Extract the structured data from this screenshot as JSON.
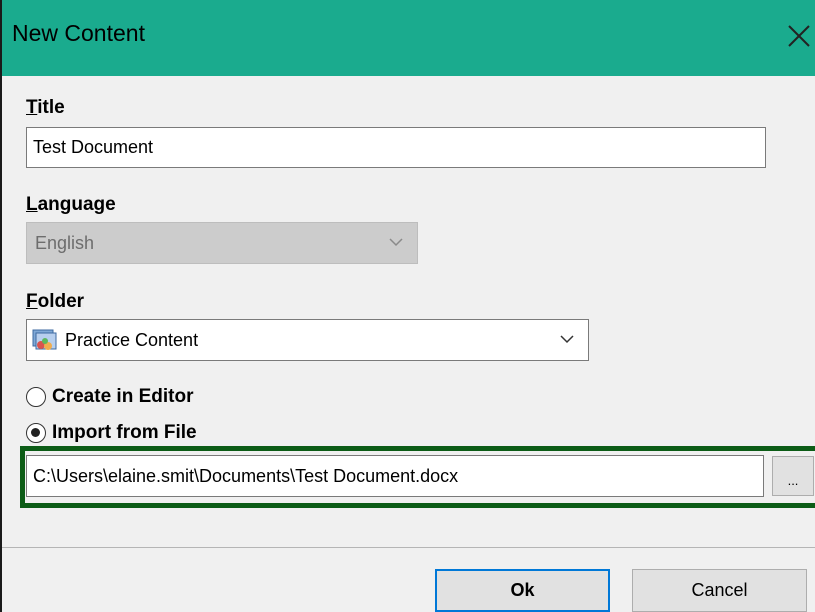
{
  "dialog": {
    "title": "New Content",
    "close_glyph": "✕"
  },
  "title_field": {
    "label_accel": "T",
    "label_rest": "itle",
    "value": "Test Document"
  },
  "language_field": {
    "label_accel": "L",
    "label_rest": "anguage",
    "value": "English",
    "disabled": true
  },
  "folder_field": {
    "label_accel": "F",
    "label_rest": "older",
    "value": "Practice Content",
    "icon": "folder-content-icon"
  },
  "source": {
    "create_label": "Create in Editor",
    "import_label": "Import from File",
    "selected": "import"
  },
  "file": {
    "path": "C:\\Users\\elaine.smit\\Documents\\Test Document.docx",
    "browse_label": "..."
  },
  "buttons": {
    "ok_label": "Ok",
    "cancel_label": "Cancel"
  },
  "colors": {
    "titlebar": "#1aab8e",
    "highlight": "#0c5c16"
  }
}
